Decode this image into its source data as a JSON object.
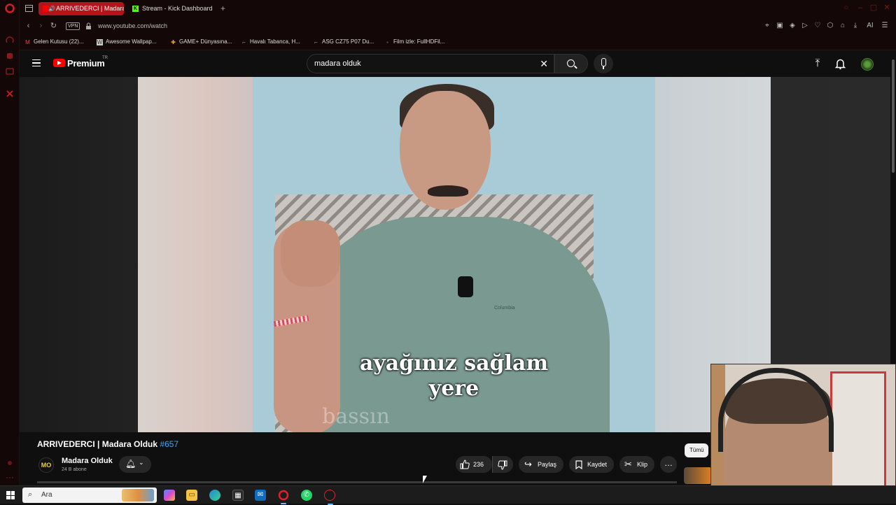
{
  "browser": {
    "tabs": [
      {
        "title": "ARRIVEDERCI | Madara",
        "active": true
      },
      {
        "title": "Stream - Kick Dashboard",
        "active": false
      }
    ],
    "new_tab_label": "+",
    "vpn_label": "VPN",
    "url": "www.youtube.com/watch",
    "ai_label": "AI",
    "bookmarks": [
      "Gelen Kutusu (22)...",
      "Awesome Wallpap...",
      "GAME+ Dünyasına...",
      "Havalı Tabanca, H...",
      "ASG CZ75 P07 Du...",
      "Film izle: FullHDFil..."
    ]
  },
  "youtube": {
    "brand": "Premium",
    "country": "TR",
    "search_query": "madara olduk",
    "video": {
      "subtitle_line1": "ayağınız sağlam",
      "subtitle_line2": "yere",
      "subtitle_next": "bassın",
      "shirt_brand": "Columbia"
    },
    "title": "ARRIVEDERCI | Madara Olduk",
    "title_tag": "#657",
    "channel": {
      "avatar_text": "MO",
      "name": "Madara Olduk",
      "subscribers": "24 B abone"
    },
    "actions": {
      "like_count": "236",
      "share_label": "Paylaş",
      "save_label": "Kaydet",
      "clip_label": "Klip"
    },
    "filter_chip": "Tümü"
  },
  "taskbar": {
    "search_placeholder": "Ara"
  }
}
